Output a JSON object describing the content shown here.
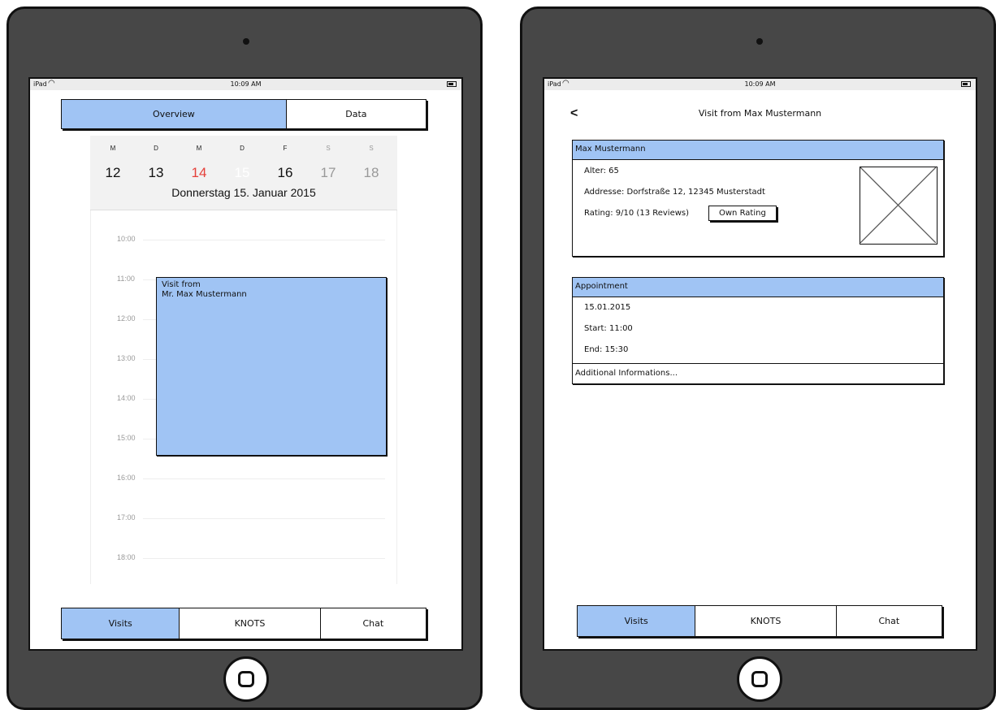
{
  "status_bar": {
    "carrier": "iPad",
    "time": "10:09 AM"
  },
  "left": {
    "tabs": [
      {
        "label": "Overview",
        "active": true
      },
      {
        "label": "Data",
        "active": false
      }
    ],
    "calendar": {
      "weekdays": [
        "M",
        "D",
        "M",
        "D",
        "F",
        "S",
        "S"
      ],
      "days": [
        "12",
        "13",
        "14",
        "15",
        "16",
        "17",
        "18"
      ],
      "selected_day": "15",
      "today_day": "14",
      "date_label": "Donnerstag  15. Januar 2015",
      "hours": [
        "10:00",
        "11:00",
        "12:00",
        "13:00",
        "14:00",
        "15:00",
        "16:00",
        "17:00",
        "18:00"
      ],
      "event": {
        "line1": "Visit from",
        "line2": "Mr. Max Mustermann",
        "start": "11:00",
        "end": "15:30"
      }
    }
  },
  "right": {
    "title": "Visit from Max Mustermann",
    "back": "<",
    "person": {
      "name": "Max Mustermann",
      "age": "Alter: 65",
      "address": "Addresse: Dorfstraße 12, 12345 Musterstadt",
      "rating": "Rating: 9/10 (13 Reviews)",
      "own_rating": "Own Rating"
    },
    "appointment": {
      "header": "Appointment",
      "date": "15.01.2015",
      "start": "Start: 11:00",
      "end": "End: 15:30",
      "additional": "Additional Informations..."
    }
  },
  "bottom_tabs": [
    {
      "label": "Visits",
      "active": true
    },
    {
      "label": "KNOTS",
      "active": false
    },
    {
      "label": "Chat",
      "active": false
    }
  ],
  "colors": {
    "accent": "#a0c4f4",
    "device": "#474747",
    "today": "#e5413b"
  }
}
